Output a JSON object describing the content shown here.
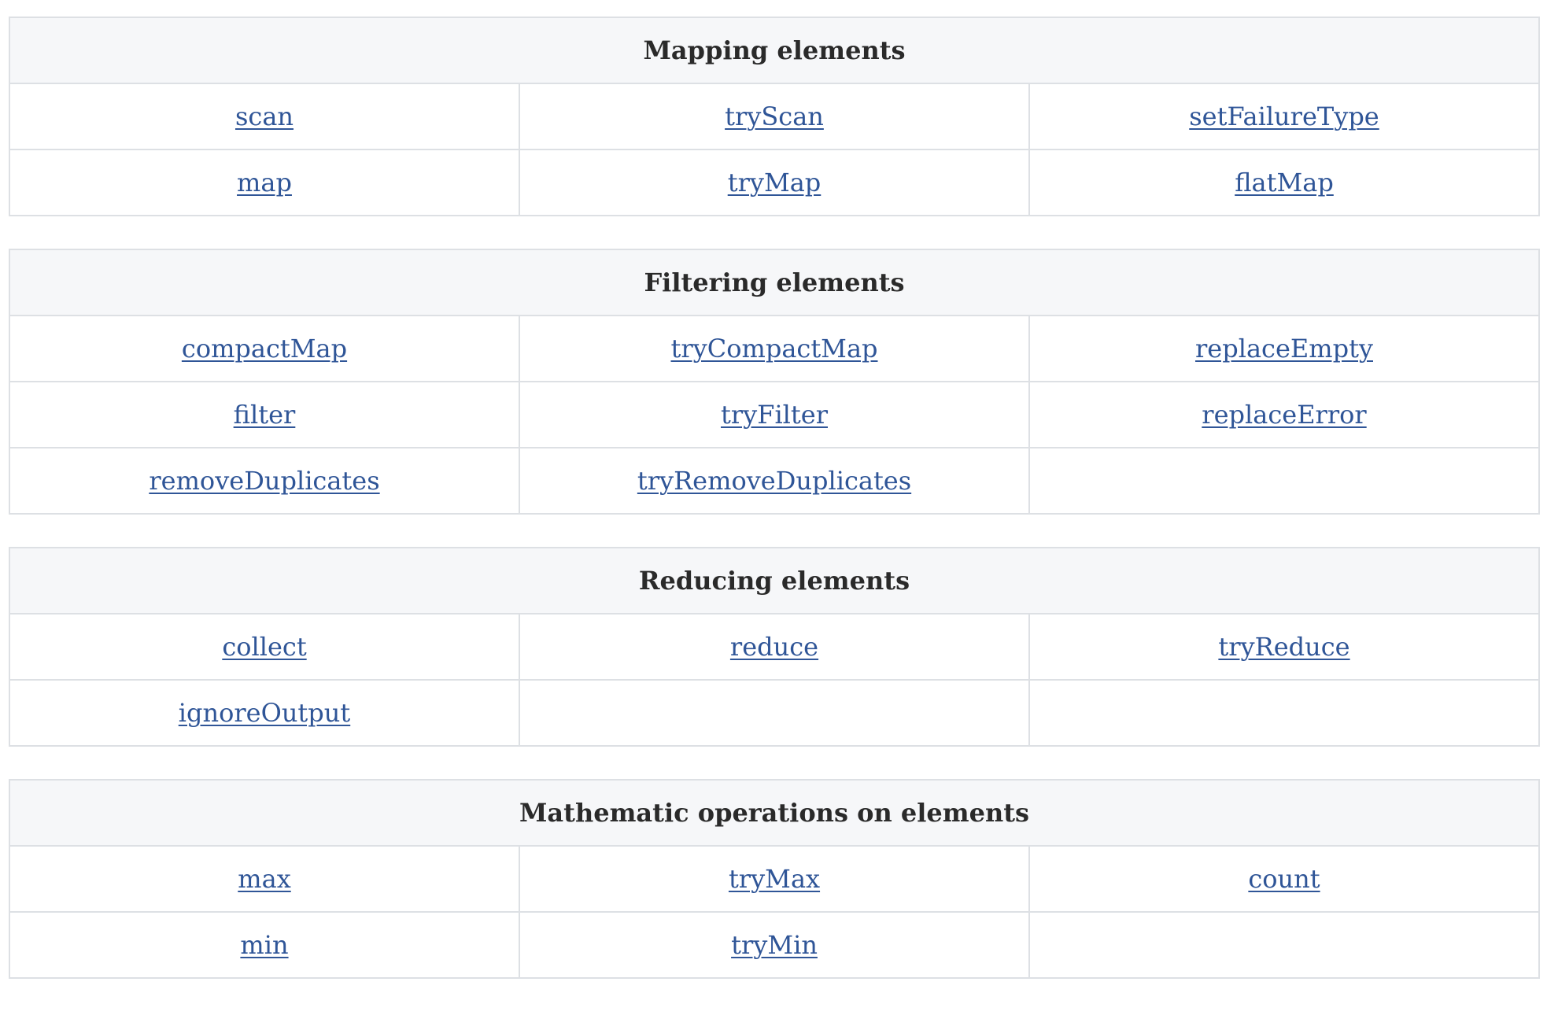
{
  "tables": [
    {
      "heading": "Mapping elements",
      "rows": [
        [
          "scan",
          "tryScan",
          "setFailureType"
        ],
        [
          "map",
          "tryMap",
          "flatMap"
        ]
      ]
    },
    {
      "heading": "Filtering elements",
      "rows": [
        [
          "compactMap",
          "tryCompactMap",
          "replaceEmpty"
        ],
        [
          "filter",
          "tryFilter",
          "replaceError"
        ],
        [
          "removeDuplicates",
          "tryRemoveDuplicates",
          ""
        ]
      ]
    },
    {
      "heading": "Reducing elements",
      "rows": [
        [
          "collect",
          "reduce",
          "tryReduce"
        ],
        [
          "ignoreOutput",
          "",
          ""
        ]
      ]
    },
    {
      "heading": "Mathematic operations on elements",
      "rows": [
        [
          "max",
          "tryMax",
          "count"
        ],
        [
          "min",
          "tryMin",
          ""
        ]
      ]
    }
  ],
  "colors": {
    "link": "#2f5597",
    "header_bg": "#f6f7f9",
    "border": "#dde0e4",
    "heading_text": "#2a2a2a"
  }
}
